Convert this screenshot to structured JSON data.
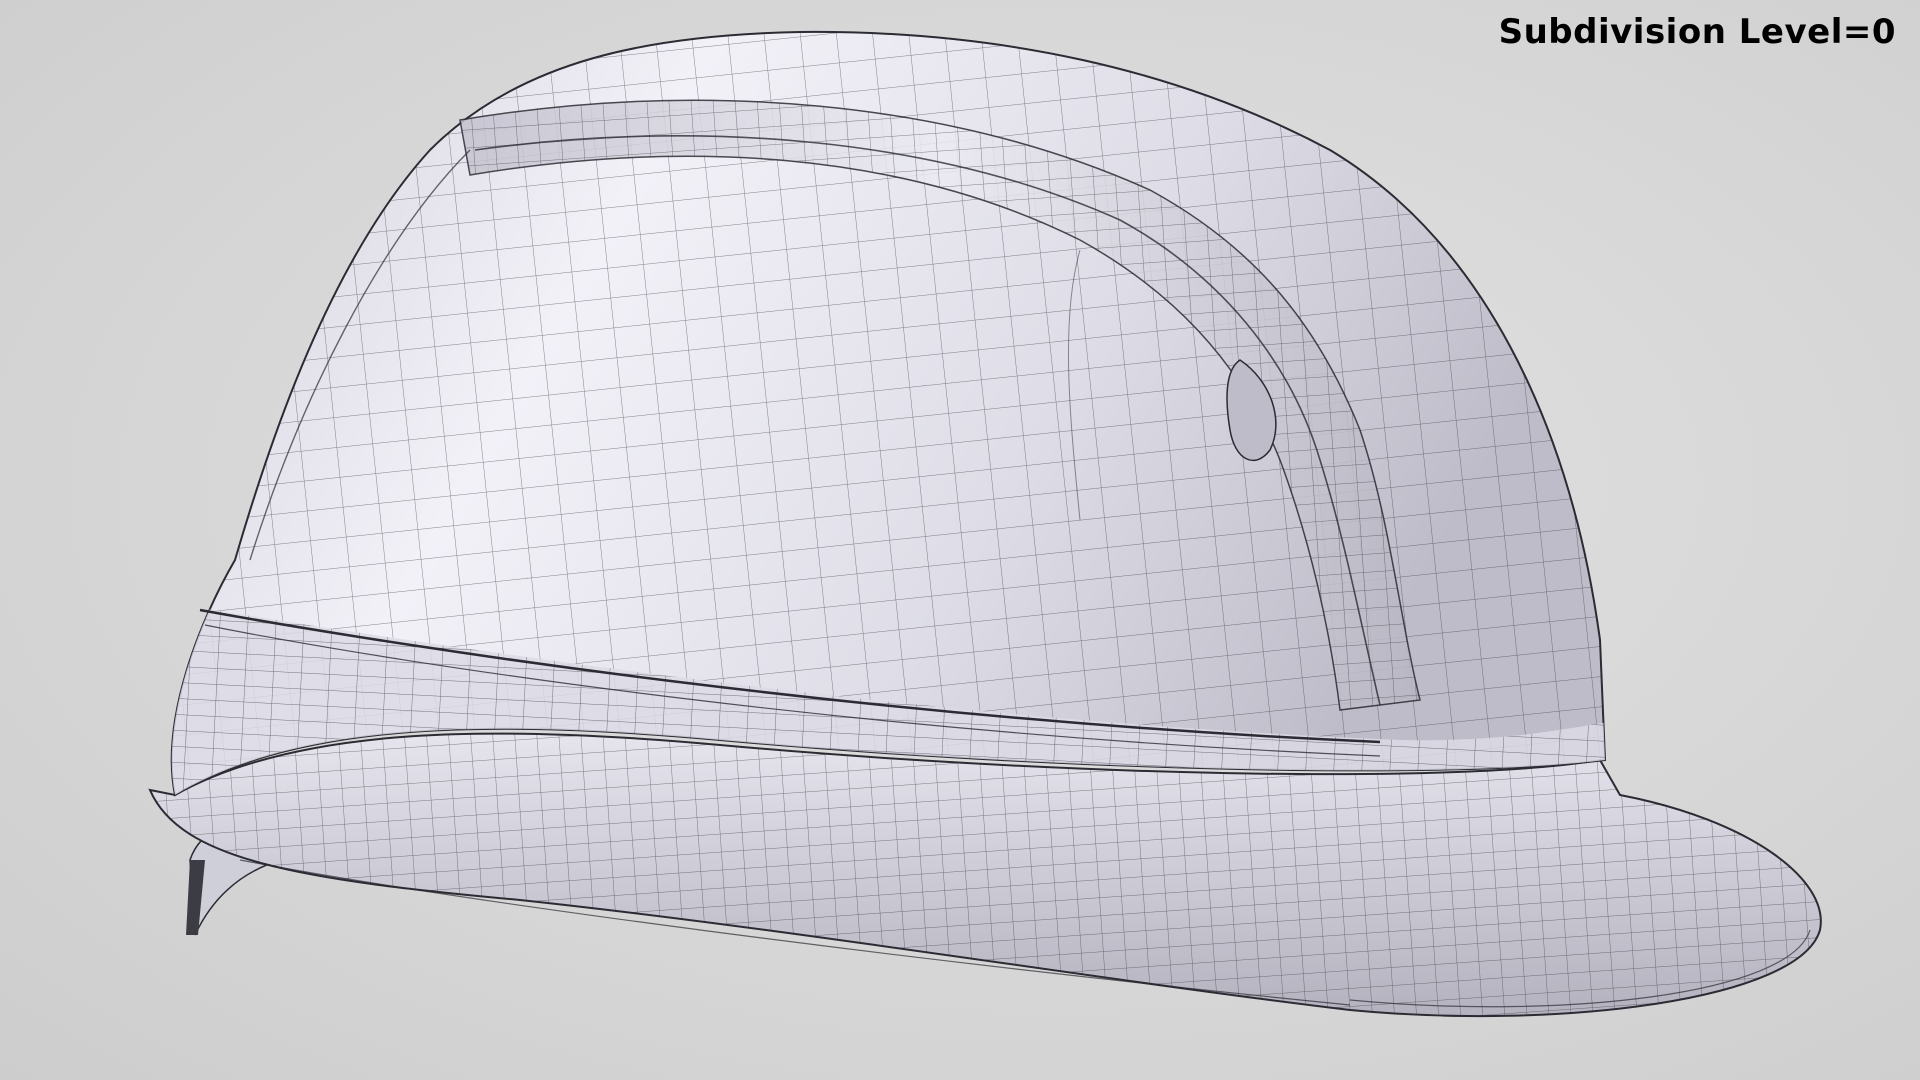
{
  "overlay": {
    "subdivision_text": "Subdivision Level=0"
  },
  "scene": {
    "subject_icon": "hard-hat-wireframe-icon",
    "colors": {
      "background": "#d7d7d7",
      "shell_light": "#f1f0f7",
      "shell_mid": "#d9d8e2",
      "shell_dark": "#a9a8b4",
      "wire": "#2b2b33"
    }
  }
}
